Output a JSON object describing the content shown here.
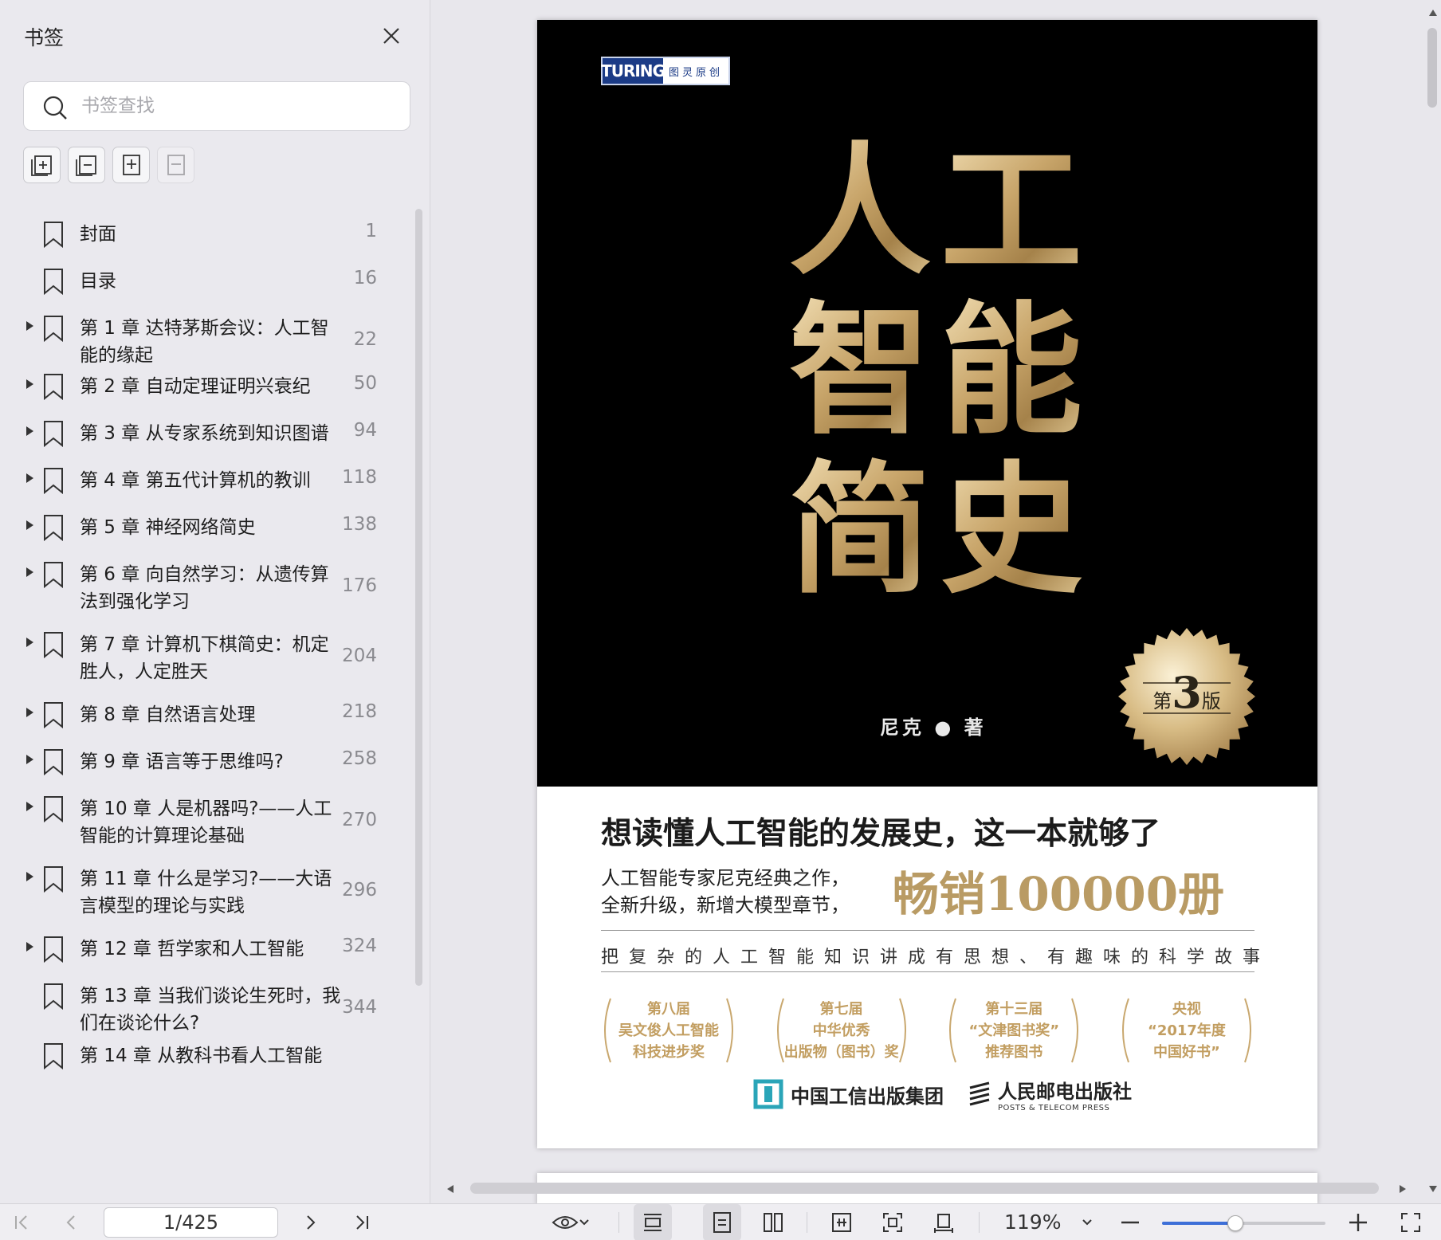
{
  "sidebar": {
    "title": "书签",
    "search_placeholder": "书签查找",
    "bookmarks": [
      {
        "label": "封面",
        "page": "1",
        "expandable": false
      },
      {
        "label": "目录",
        "page": "16",
        "expandable": false
      },
      {
        "label": "第 1 章 达特茅斯会议：人工智能的缘起",
        "page": "22",
        "expandable": true
      },
      {
        "label": "第 2 章 自动定理证明兴衰纪",
        "page": "50",
        "expandable": true
      },
      {
        "label": "第 3 章 从专家系统到知识图谱",
        "page": "94",
        "expandable": true
      },
      {
        "label": "第 4 章 第五代计算机的教训",
        "page": "118",
        "expandable": true
      },
      {
        "label": "第 5 章 神经网络简史",
        "page": "138",
        "expandable": true
      },
      {
        "label": "第 6 章 向自然学习：从遗传算法到强化学习",
        "page": "176",
        "expandable": true
      },
      {
        "label": "第 7 章 计算机下棋简史：机定胜人，人定胜天",
        "page": "204",
        "expandable": true
      },
      {
        "label": "第 8 章 自然语言处理",
        "page": "218",
        "expandable": true
      },
      {
        "label": "第 9 章 语言等于思维吗?",
        "page": "258",
        "expandable": true
      },
      {
        "label": "第 10 章 人是机器吗?——人工智能的计算理论基础",
        "page": "270",
        "expandable": true
      },
      {
        "label": "第 11 章 什么是学习?——大语言模型的理论与实践",
        "page": "296",
        "expandable": true
      },
      {
        "label": "第 12 章 哲学家和人工智能",
        "page": "324",
        "expandable": true
      },
      {
        "label": "第 13 章 当我们谈论生死时，我们在谈论什么?",
        "page": "344",
        "expandable": false
      },
      {
        "label": "第 14 章 从教科书看人工智能",
        "page": "",
        "expandable": false
      }
    ]
  },
  "cover": {
    "publisher_logo_left": "TURING",
    "publisher_logo_right": "图灵原创",
    "title_chars": [
      "人",
      "工",
      "智",
      "能",
      "简",
      "史"
    ],
    "author": "尼克 ● 著",
    "edition_prefix": "第",
    "edition_number": "3",
    "edition_suffix": "版",
    "tagline": "想读懂人工智能的发展史，这一本就够了",
    "subtitle_line1": "人工智能专家尼克经典之作，",
    "subtitle_line2": "全新升级，新增大模型章节，",
    "sales": "畅销100000册",
    "motto": "把复杂的人工智能知识讲成有思想、有趣味的科学故事",
    "awards": [
      {
        "lines": [
          "第八届",
          "吴文俊人工智能",
          "科技进步奖"
        ]
      },
      {
        "lines": [
          "第七届",
          "中华优秀",
          "出版物（图书）奖"
        ]
      },
      {
        "lines": [
          "第十三届",
          "“文津图书奖”",
          "推荐图书"
        ]
      },
      {
        "lines": [
          "央视",
          "“2017年度",
          "中国好书”"
        ]
      }
    ],
    "publisher1": "中国工信出版集团",
    "publisher2": "人民邮电出版社",
    "publisher2_en": "POSTS & TELECOM PRESS"
  },
  "toolbar": {
    "page_indicator": "1/425",
    "zoom": "119%",
    "zoom_slider_fraction": 0.45
  },
  "colors": {
    "gold": "#c29e61",
    "accent": "#3d6fd8"
  }
}
